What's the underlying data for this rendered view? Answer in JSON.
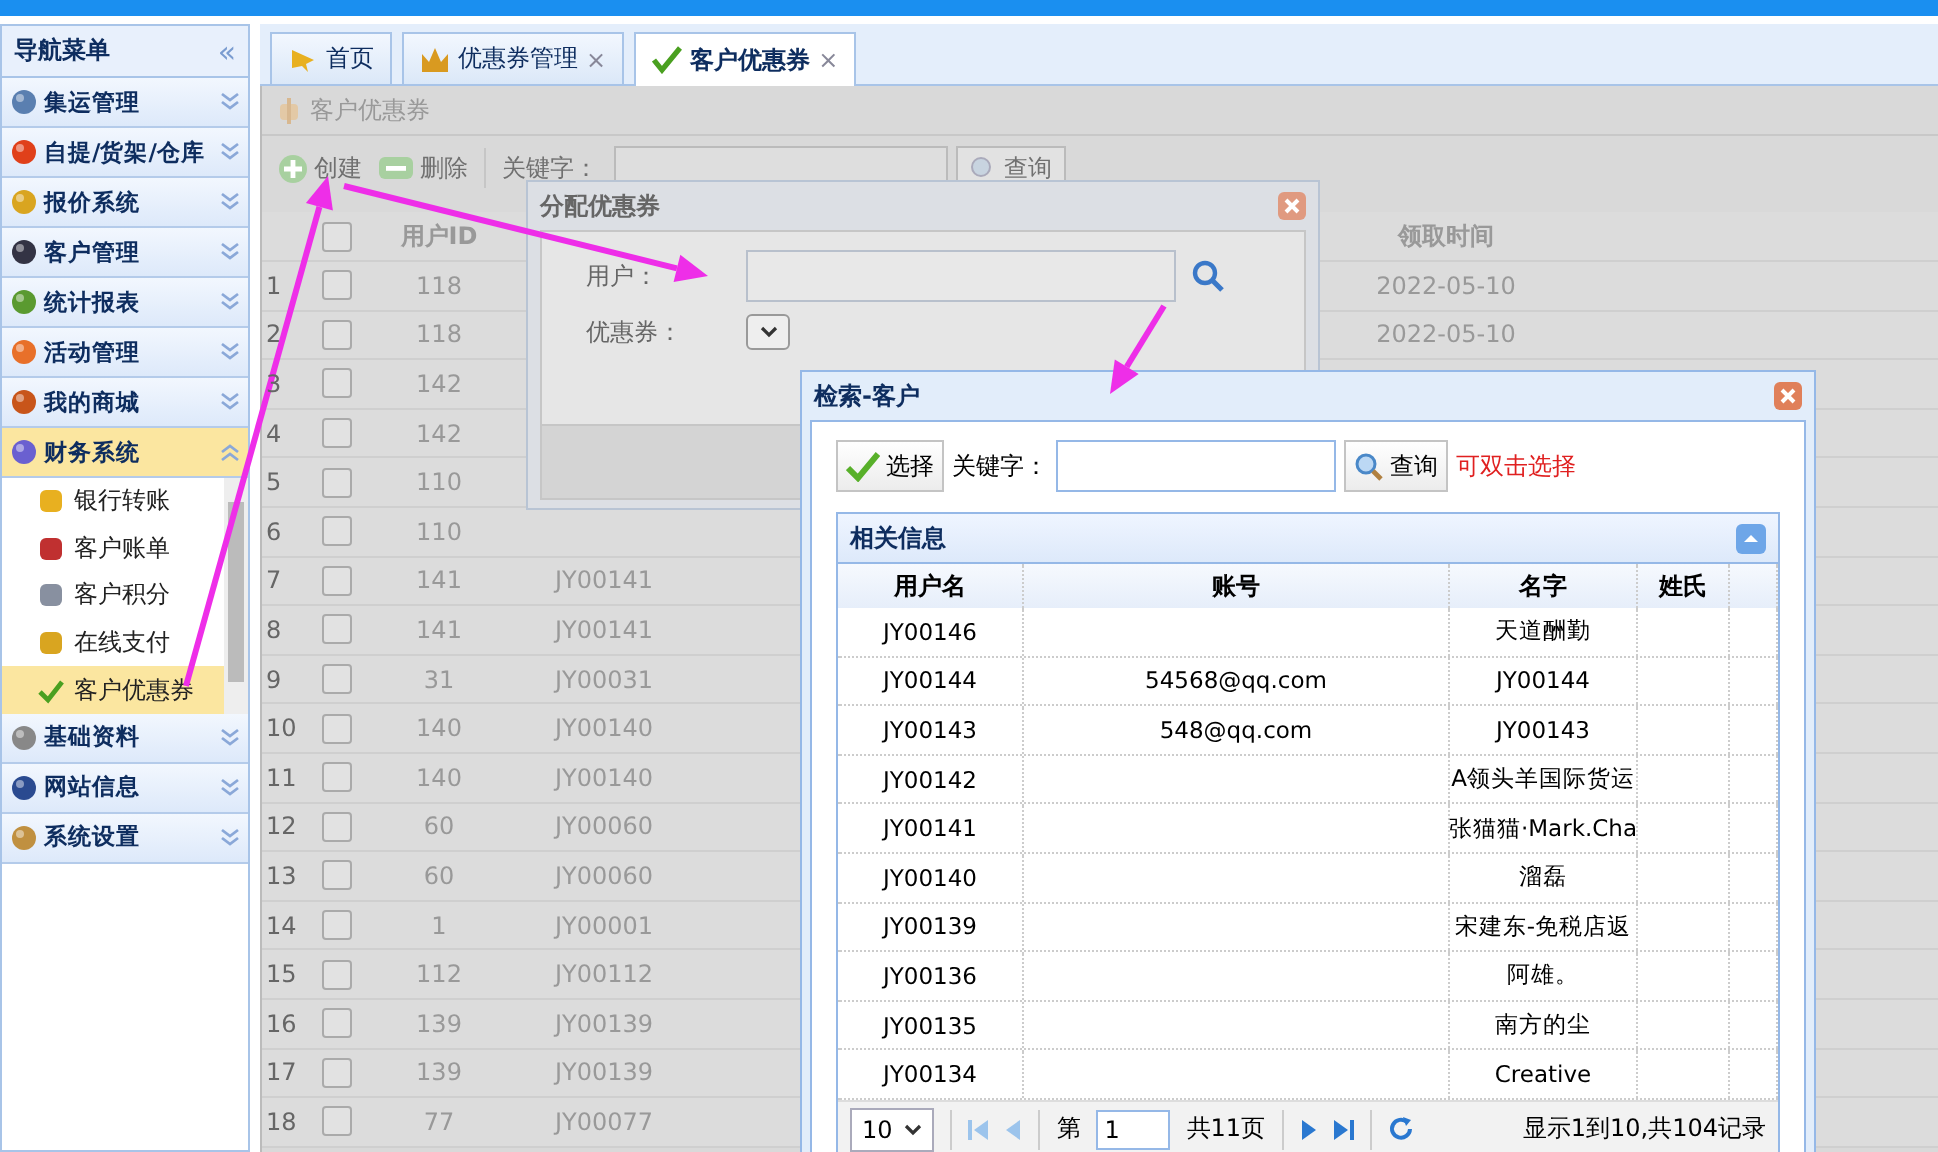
{
  "sidebar": {
    "title": "导航菜单",
    "collapse": "«",
    "sections": [
      {
        "label": "集运管理",
        "expanded": false
      },
      {
        "label": "自提/货架/仓库",
        "expanded": false
      },
      {
        "label": "报价系统",
        "expanded": false
      },
      {
        "label": "客户管理",
        "expanded": false
      },
      {
        "label": "统计报表",
        "expanded": false
      },
      {
        "label": "活动管理",
        "expanded": false
      },
      {
        "label": "我的商城",
        "expanded": false
      },
      {
        "label": "财务系统",
        "expanded": true,
        "items": [
          {
            "label": "银行转账",
            "selected": false
          },
          {
            "label": "客户账单",
            "selected": false
          },
          {
            "label": "客户积分",
            "selected": false
          },
          {
            "label": "在线支付",
            "selected": false
          },
          {
            "label": "客户优惠券",
            "selected": true
          }
        ]
      },
      {
        "label": "基础资料",
        "expanded": false
      },
      {
        "label": "网站信息",
        "expanded": false
      },
      {
        "label": "系统设置",
        "expanded": false
      }
    ]
  },
  "tabs": [
    {
      "label": "首页",
      "selected": false
    },
    {
      "label": "优惠券管理",
      "selected": false,
      "close": "×"
    },
    {
      "label": "客户优惠券",
      "selected": true,
      "close": "×"
    }
  ],
  "panel": {
    "title": "客户优惠券",
    "toolbar": {
      "buttons": [
        {
          "label": "创建",
          "kind": "create"
        },
        {
          "label": "删除",
          "kind": "delete"
        }
      ],
      "keyword_label": "关键字：",
      "search_button": "查询"
    },
    "table": {
      "all_checked": false,
      "headers": {
        "user_id": "用户ID",
        "received_time": "领取时间"
      },
      "rows": [
        {
          "index": "1",
          "checked": false,
          "user_id": "118",
          "received_time": "2022-05-10"
        },
        {
          "index": "2",
          "checked": false,
          "user_id": "118",
          "received_time": "2022-05-10"
        },
        {
          "index": "3",
          "checked": false,
          "user_id": "142"
        },
        {
          "index": "4",
          "checked": false,
          "user_id": "142"
        },
        {
          "index": "5",
          "checked": false,
          "user_id": "110"
        },
        {
          "index": "6",
          "checked": false,
          "user_id": "110"
        },
        {
          "index": "7",
          "checked": false,
          "user_id": "141",
          "account": "JY00141"
        },
        {
          "index": "8",
          "checked": false,
          "user_id": "141",
          "account": "JY00141"
        },
        {
          "index": "9",
          "checked": false,
          "user_id": "31",
          "account": "JY00031"
        },
        {
          "index": "10",
          "checked": false,
          "user_id": "140",
          "account": "JY00140"
        },
        {
          "index": "11",
          "checked": false,
          "user_id": "140",
          "account": "JY00140"
        },
        {
          "index": "12",
          "checked": false,
          "user_id": "60",
          "account": "JY00060"
        },
        {
          "index": "13",
          "checked": false,
          "user_id": "60",
          "account": "JY00060"
        },
        {
          "index": "14",
          "checked": false,
          "user_id": "1",
          "account": "JY00001"
        },
        {
          "index": "15",
          "checked": false,
          "user_id": "112",
          "account": "JY00112"
        },
        {
          "index": "16",
          "checked": false,
          "user_id": "139",
          "account": "JY00139"
        },
        {
          "index": "17",
          "checked": false,
          "user_id": "139",
          "account": "JY00139"
        },
        {
          "index": "18",
          "checked": false,
          "user_id": "77",
          "account": "JY00077"
        }
      ]
    }
  },
  "assign_dialog": {
    "title": "分配优惠券",
    "user_label": "用户：",
    "coupon_label": "优惠券："
  },
  "search_dialog": {
    "title": "检索-客户",
    "select_button": "选择",
    "keyword_label": "关键字：",
    "search_button": "查询",
    "hint": "可双击选择",
    "section_title": "相关信息",
    "columns": [
      "用户名",
      "账号",
      "名字",
      "姓氏"
    ],
    "rows": [
      {
        "username": "JY00146",
        "name": "天道酬勤"
      },
      {
        "username": "JY00144",
        "account": "54568@qq.com",
        "name": "JY00144"
      },
      {
        "username": "JY00143",
        "account": "548@qq.com",
        "name": "JY00143"
      },
      {
        "username": "JY00142",
        "name": "A领头羊国际货运"
      },
      {
        "username": "JY00141",
        "name": "张猫猫·Mark.Cha"
      },
      {
        "username": "JY00140",
        "name": "溜磊"
      },
      {
        "username": "JY00139",
        "name": "宋建东-免税店返"
      },
      {
        "username": "JY00136",
        "name": "阿雄。"
      },
      {
        "username": "JY00135",
        "name": "南方的尘"
      },
      {
        "username": "JY00134",
        "name": "Creative"
      }
    ],
    "pager": {
      "page_size": "10",
      "page_prefix": "第",
      "page": "1",
      "page_total": "共11页",
      "summary": "显示1到10,共104记录"
    }
  }
}
